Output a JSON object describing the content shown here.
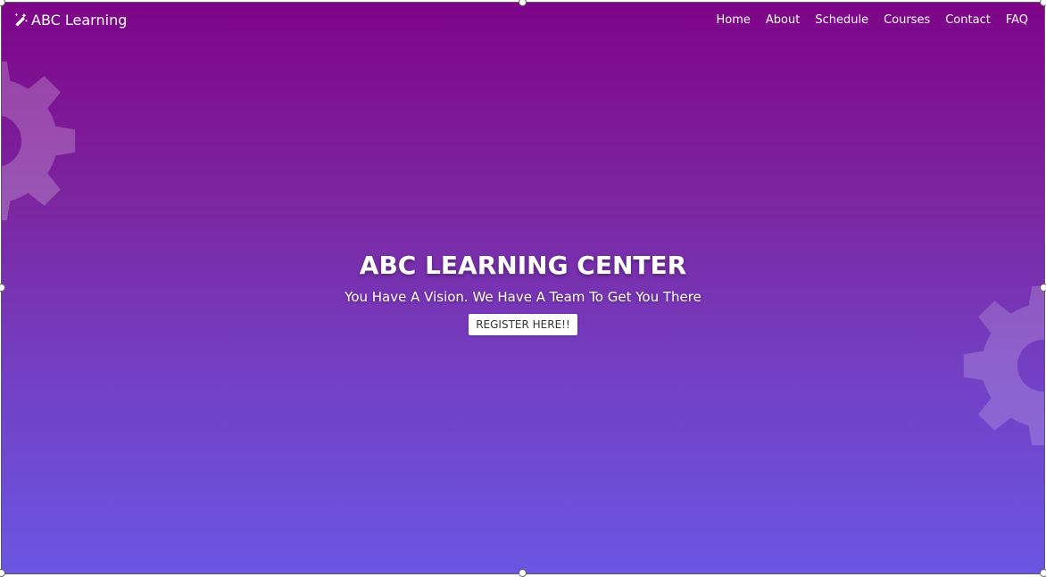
{
  "brand": {
    "name": "ABC Learning",
    "icon": "magic-wand-icon"
  },
  "nav": {
    "items": [
      {
        "label": "Home"
      },
      {
        "label": "About"
      },
      {
        "label": "Schedule"
      },
      {
        "label": "Courses"
      },
      {
        "label": "Contact"
      },
      {
        "label": "FAQ"
      }
    ]
  },
  "hero": {
    "title": "ABC LEARNING CENTER",
    "tagline": "You Have A Vision. We Have A Team To Get You There",
    "cta_label": "REGISTER HERE!!"
  },
  "decor": {
    "gear_icon": "gear-icon"
  },
  "colors": {
    "gradient_top": "#7e0488",
    "gradient_bottom": "#6a56e2",
    "text": "#ffffff"
  }
}
